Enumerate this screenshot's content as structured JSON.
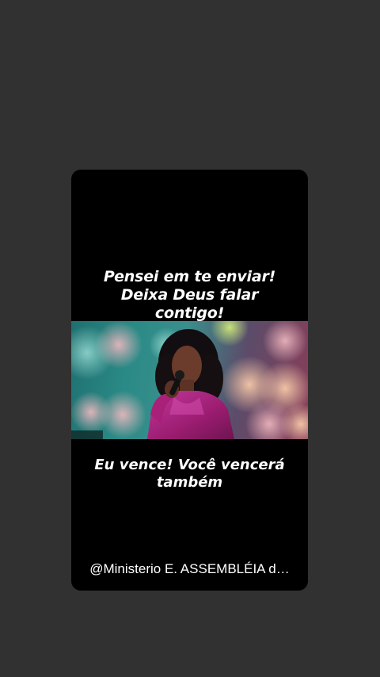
{
  "post": {
    "caption_top": [
      "Pensei em te enviar!",
      "Deixa Deus falar",
      "contigo!"
    ],
    "caption_bottom": [
      "Eu vence! Você vencerá",
      "também"
    ],
    "handle": "@Ministerio E. ASSEMBLÉIA d…"
  },
  "colors": {
    "page_background": "#313131",
    "card_background": "#000000",
    "text": "#ffffff",
    "dress": "#b0277f"
  }
}
